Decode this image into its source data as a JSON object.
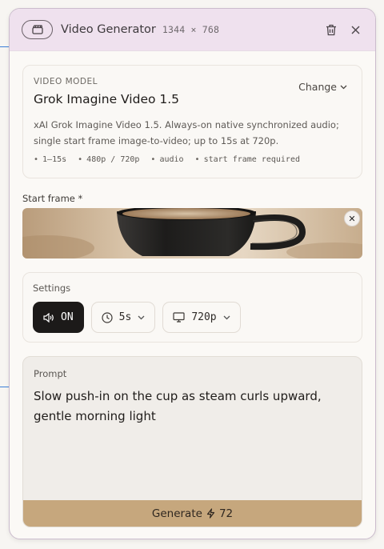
{
  "window": {
    "title": "Video Generator",
    "dimensions": "1344 × 768"
  },
  "model": {
    "section_label": "VIDEO MODEL",
    "name": "Grok Imagine Video 1.5",
    "change_label": "Change",
    "description": "xAI Grok Imagine Video 1.5. Always-on native synchronized audio; single start frame image-to-video; up to 15s at 720p.",
    "specs": [
      "1–15s",
      "480p / 720p",
      "audio",
      "start frame required"
    ]
  },
  "start_frame": {
    "label": "Start frame *"
  },
  "settings": {
    "label": "Settings",
    "audio": "ON",
    "duration": "5s",
    "resolution": "720p"
  },
  "prompt": {
    "label": "Prompt",
    "text": "Slow push-in on the cup as steam curls upward, gentle morning light"
  },
  "generate": {
    "label": "Generate",
    "cost": "72"
  },
  "colors": {
    "header": "#efe1ee",
    "generate": "#c6a77d",
    "audio_on": "#1c1a19"
  }
}
